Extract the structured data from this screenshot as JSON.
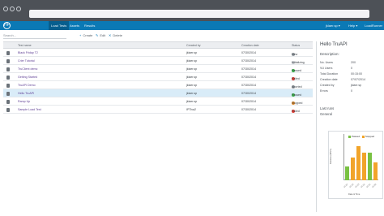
{
  "nav": {
    "tabs": [
      "Load Tests",
      "Assets",
      "Results"
    ],
    "user": "jklaer.sp ▾",
    "help": "Help ▾",
    "brand": "HP",
    "product": "LoadRunner ▾"
  },
  "toolbar": {
    "search_placeholder": "Search...",
    "create_label": "Create",
    "edit_label": "Edit",
    "delete_label": "Delete"
  },
  "table": {
    "columns": [
      "Test name",
      "Created by",
      "Creation date",
      "Status"
    ],
    "rows": [
      {
        "name": "Black Friday T2",
        "created_by": "jklaer.sp",
        "date": "07/30/2014",
        "status": "New",
        "status_color": "#9aa0a6"
      },
      {
        "name": "Crier Tutorial",
        "created_by": "jklaer.sp",
        "date": "07/30/2014",
        "status": "Initializing",
        "status_color": "#c8ccd0"
      },
      {
        "name": "TruClient demo",
        "created_by": "jklaer.sp",
        "date": "07/30/2014",
        "status": "Passed",
        "status_color": "#3bb54a"
      },
      {
        "name": "Getting Started",
        "created_by": "jklaer.sp",
        "date": "07/30/2014",
        "status": "Failed",
        "status_color": "#e23b32"
      },
      {
        "name": "TruAPI Demo",
        "created_by": "jklaer.sp",
        "date": "07/30/2014",
        "status": "Aborted",
        "status_color": "#9aa0a6"
      },
      {
        "name": "Hello TruAPI",
        "created_by": "jklaer.sp",
        "date": "07/30/2014",
        "status": "Passed",
        "status_color": "#3bb54a"
      },
      {
        "name": "Ramp Up",
        "created_by": "jklaer.sp",
        "date": "07/30/2014",
        "status": "Stopped",
        "status_color": "#e48a23"
      },
      {
        "name": "Sample Load Test",
        "created_by": "IPTiva2",
        "date": "07/30/2014",
        "status": "Failed",
        "status_color": "#e23b32"
      }
    ],
    "selected_index": 5
  },
  "details": {
    "title": "Hello TruAPI",
    "section": "Description:",
    "fields": [
      {
        "label": "No. Users",
        "value": "200"
      },
      {
        "label": "VU Users",
        "value": "0"
      },
      {
        "label": "Total Duration",
        "value": "00:15:00"
      },
      {
        "label": "Creation date",
        "value": "07/07/2014"
      },
      {
        "label": "Created by",
        "value": "jklaer.sp"
      },
      {
        "label": "Errors",
        "value": "0"
      }
    ],
    "last_run": "Last runs",
    "general": "General"
  },
  "chart_data": {
    "type": "bar",
    "legend": [
      "Passed",
      "Stopped"
    ],
    "colors": [
      "#79c142",
      "#f1a42a"
    ],
    "categories": [
      "07.07",
      "07.10",
      "07.13",
      "07.16",
      "07.21",
      "07.29"
    ],
    "series": [
      {
        "name": "Passed",
        "values": [
          30,
          0,
          0,
          0,
          60,
          0
        ]
      },
      {
        "name": "Stopped",
        "values": [
          0,
          50,
          75,
          60,
          0,
          40
        ]
      }
    ],
    "ylabel": "Duration (MINS)",
    "xlabel": "Date & Time",
    "ylim": [
      0,
      100
    ]
  }
}
